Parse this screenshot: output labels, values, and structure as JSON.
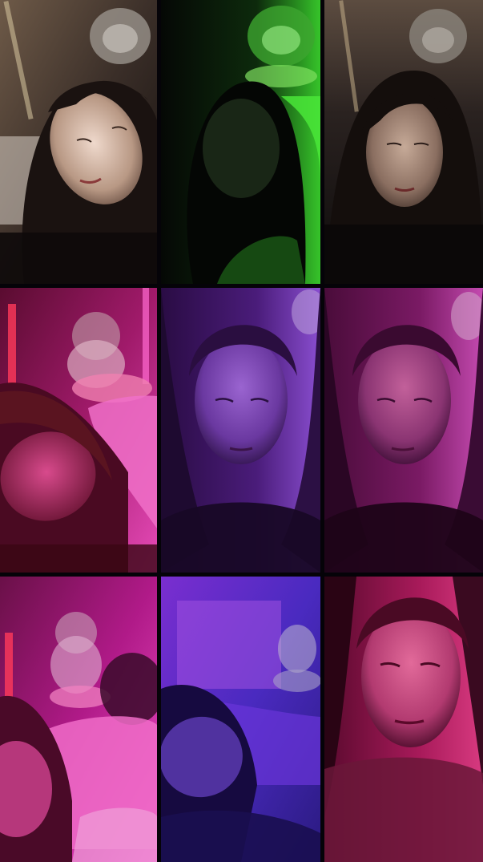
{
  "collage": {
    "tiles": [
      {
        "id": "r1c1",
        "tint": "#8a7a6a",
        "mood": "warm"
      },
      {
        "id": "r1c2",
        "tint": "#2fd62a",
        "mood": "green"
      },
      {
        "id": "r1c3",
        "tint": "#6c5e52",
        "mood": "warm"
      },
      {
        "id": "r2c1",
        "tint": "#d8249a",
        "mood": "magenta"
      },
      {
        "id": "r2c2",
        "tint": "#6a2bb8",
        "mood": "violet"
      },
      {
        "id": "r2c3",
        "tint": "#a62c8a",
        "mood": "magenta"
      },
      {
        "id": "r3c1",
        "tint": "#d418a0",
        "mood": "magenta"
      },
      {
        "id": "r3c2",
        "tint": "#4a2ad6",
        "mood": "blue-violet"
      },
      {
        "id": "r3c3",
        "tint": "#c81e7a",
        "mood": "pink"
      }
    ]
  }
}
